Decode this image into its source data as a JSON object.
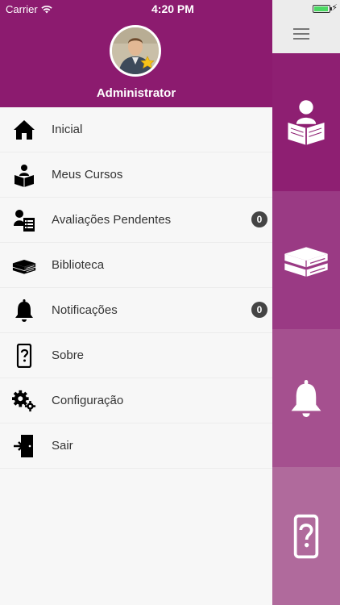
{
  "status_bar": {
    "carrier": "Carrier",
    "time": "4:20 PM"
  },
  "user": {
    "name": "Administrator"
  },
  "menu": [
    {
      "label": "Inicial",
      "icon": "home-icon",
      "badge": null
    },
    {
      "label": "Meus Cursos",
      "icon": "reader-icon",
      "badge": null
    },
    {
      "label": "Avaliações Pendentes",
      "icon": "user-list-icon",
      "badge": "0"
    },
    {
      "label": "Biblioteca",
      "icon": "books-icon",
      "badge": null
    },
    {
      "label": "Notificações",
      "icon": "bell-icon",
      "badge": "0"
    },
    {
      "label": "Sobre",
      "icon": "phone-question-icon",
      "badge": null
    },
    {
      "label": "Configuração",
      "icon": "gears-icon",
      "badge": null
    },
    {
      "label": "Sair",
      "icon": "exit-icon",
      "badge": null
    }
  ],
  "colors": {
    "primary": "#8c1b6f",
    "tile_1": "#8e1f72",
    "tile_2": "#9a3a84",
    "tile_3": "#a5508f",
    "tile_4": "#b06a9c"
  }
}
